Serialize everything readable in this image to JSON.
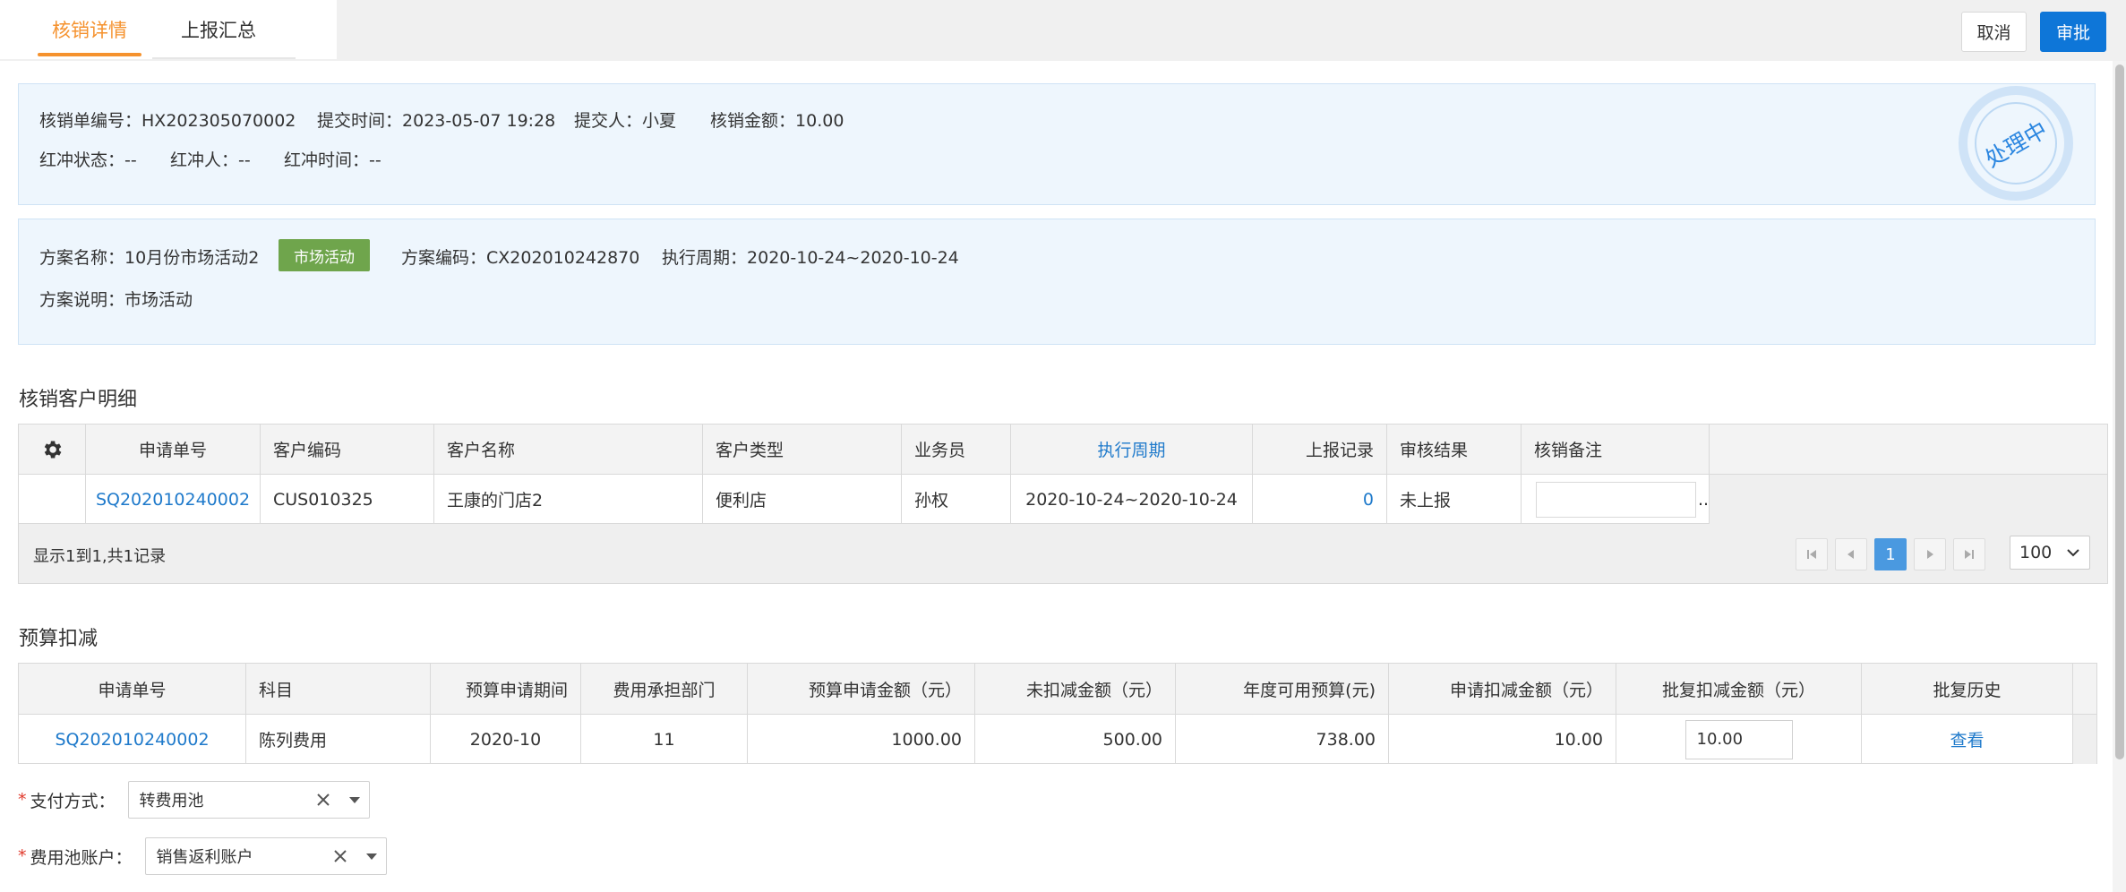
{
  "tabs": [
    {
      "label": "核销详情",
      "active": true
    },
    {
      "label": "上报汇总",
      "active": false
    }
  ],
  "actions": {
    "cancel": "取消",
    "approve": "审批"
  },
  "summary": {
    "order_no_label": "核销单编号：",
    "order_no": "HX202305070002",
    "submit_time_label": "提交时间：",
    "submit_time": "2023-05-07 19:28",
    "submitter_label": "提交人：",
    "submitter": "小夏",
    "amount_label": "核销金额：",
    "amount": "10.00",
    "red_status_label": "红冲状态：",
    "red_status": "--",
    "red_person_label": "红冲人：",
    "red_person": "--",
    "red_time_label": "红冲时间：",
    "red_time": "--",
    "stamp": "处理中"
  },
  "plan": {
    "name_label": "方案名称：",
    "name": "10月份市场活动2",
    "tag": "市场活动",
    "code_label": "方案编码：",
    "code": "CX202010242870",
    "period_label": "执行周期：",
    "period": "2020-10-24~2020-10-24",
    "desc_label": "方案说明：",
    "desc": "市场活动"
  },
  "customer_section": {
    "title": "核销客户明细",
    "columns": [
      "申请单号",
      "客户编码",
      "客户名称",
      "客户类型",
      "业务员",
      "执行周期",
      "上报记录",
      "审核结果",
      "核销备注"
    ],
    "rows": [
      {
        "apply_no": "SQ202010240002",
        "cust_code": "CUS010325",
        "cust_name": "王康的门店2",
        "cust_type": "便利店",
        "salesman": "孙权",
        "period": "2020-10-24~2020-10-24",
        "records": "0",
        "result": "未上报",
        "note": "",
        "ellipsis": ".."
      }
    ],
    "footer_text": "显示1到1,共1记录",
    "current_page": "1",
    "page_size": "100"
  },
  "budget_section": {
    "title": "预算扣减",
    "columns": [
      "申请单号",
      "科目",
      "预算申请期间",
      "费用承担部门",
      "预算申请金额（元）",
      "未扣减金额（元）",
      "年度可用预算(元)",
      "申请扣减金额（元）",
      "批复扣减金额（元）",
      "批复历史"
    ],
    "rows": [
      {
        "apply_no": "SQ202010240002",
        "subject": "陈列费用",
        "period": "2020-10",
        "dept": "11",
        "apply_amount": "1000.00",
        "undeducted": "500.00",
        "annual_available": "738.00",
        "apply_deduct": "10.00",
        "approved_deduct": "10.00",
        "history": "查看"
      }
    ]
  },
  "form": {
    "pay_method_label": "支付方式：",
    "pay_method": "转费用池",
    "pool_account_label": "费用池账户：",
    "pool_account": "销售返利账户"
  },
  "colors": {
    "accent_orange": "#f5922e",
    "primary_blue": "#0e76d8",
    "link_blue": "#1f7acb",
    "tag_green": "#6fa54c"
  }
}
